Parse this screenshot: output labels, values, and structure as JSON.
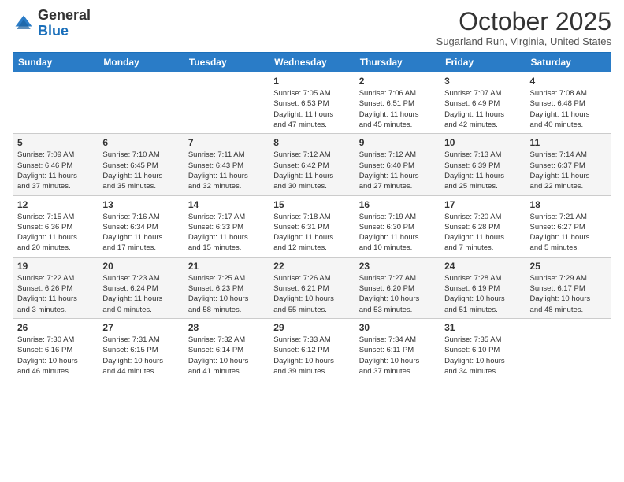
{
  "logo": {
    "general": "General",
    "blue": "Blue"
  },
  "header": {
    "month": "October 2025",
    "location": "Sugarland Run, Virginia, United States"
  },
  "weekdays": [
    "Sunday",
    "Monday",
    "Tuesday",
    "Wednesday",
    "Thursday",
    "Friday",
    "Saturday"
  ],
  "weeks": [
    [
      {
        "day": "",
        "info": ""
      },
      {
        "day": "",
        "info": ""
      },
      {
        "day": "",
        "info": ""
      },
      {
        "day": "1",
        "info": "Sunrise: 7:05 AM\nSunset: 6:53 PM\nDaylight: 11 hours\nand 47 minutes."
      },
      {
        "day": "2",
        "info": "Sunrise: 7:06 AM\nSunset: 6:51 PM\nDaylight: 11 hours\nand 45 minutes."
      },
      {
        "day": "3",
        "info": "Sunrise: 7:07 AM\nSunset: 6:49 PM\nDaylight: 11 hours\nand 42 minutes."
      },
      {
        "day": "4",
        "info": "Sunrise: 7:08 AM\nSunset: 6:48 PM\nDaylight: 11 hours\nand 40 minutes."
      }
    ],
    [
      {
        "day": "5",
        "info": "Sunrise: 7:09 AM\nSunset: 6:46 PM\nDaylight: 11 hours\nand 37 minutes."
      },
      {
        "day": "6",
        "info": "Sunrise: 7:10 AM\nSunset: 6:45 PM\nDaylight: 11 hours\nand 35 minutes."
      },
      {
        "day": "7",
        "info": "Sunrise: 7:11 AM\nSunset: 6:43 PM\nDaylight: 11 hours\nand 32 minutes."
      },
      {
        "day": "8",
        "info": "Sunrise: 7:12 AM\nSunset: 6:42 PM\nDaylight: 11 hours\nand 30 minutes."
      },
      {
        "day": "9",
        "info": "Sunrise: 7:12 AM\nSunset: 6:40 PM\nDaylight: 11 hours\nand 27 minutes."
      },
      {
        "day": "10",
        "info": "Sunrise: 7:13 AM\nSunset: 6:39 PM\nDaylight: 11 hours\nand 25 minutes."
      },
      {
        "day": "11",
        "info": "Sunrise: 7:14 AM\nSunset: 6:37 PM\nDaylight: 11 hours\nand 22 minutes."
      }
    ],
    [
      {
        "day": "12",
        "info": "Sunrise: 7:15 AM\nSunset: 6:36 PM\nDaylight: 11 hours\nand 20 minutes."
      },
      {
        "day": "13",
        "info": "Sunrise: 7:16 AM\nSunset: 6:34 PM\nDaylight: 11 hours\nand 17 minutes."
      },
      {
        "day": "14",
        "info": "Sunrise: 7:17 AM\nSunset: 6:33 PM\nDaylight: 11 hours\nand 15 minutes."
      },
      {
        "day": "15",
        "info": "Sunrise: 7:18 AM\nSunset: 6:31 PM\nDaylight: 11 hours\nand 12 minutes."
      },
      {
        "day": "16",
        "info": "Sunrise: 7:19 AM\nSunset: 6:30 PM\nDaylight: 11 hours\nand 10 minutes."
      },
      {
        "day": "17",
        "info": "Sunrise: 7:20 AM\nSunset: 6:28 PM\nDaylight: 11 hours\nand 7 minutes."
      },
      {
        "day": "18",
        "info": "Sunrise: 7:21 AM\nSunset: 6:27 PM\nDaylight: 11 hours\nand 5 minutes."
      }
    ],
    [
      {
        "day": "19",
        "info": "Sunrise: 7:22 AM\nSunset: 6:26 PM\nDaylight: 11 hours\nand 3 minutes."
      },
      {
        "day": "20",
        "info": "Sunrise: 7:23 AM\nSunset: 6:24 PM\nDaylight: 11 hours\nand 0 minutes."
      },
      {
        "day": "21",
        "info": "Sunrise: 7:25 AM\nSunset: 6:23 PM\nDaylight: 10 hours\nand 58 minutes."
      },
      {
        "day": "22",
        "info": "Sunrise: 7:26 AM\nSunset: 6:21 PM\nDaylight: 10 hours\nand 55 minutes."
      },
      {
        "day": "23",
        "info": "Sunrise: 7:27 AM\nSunset: 6:20 PM\nDaylight: 10 hours\nand 53 minutes."
      },
      {
        "day": "24",
        "info": "Sunrise: 7:28 AM\nSunset: 6:19 PM\nDaylight: 10 hours\nand 51 minutes."
      },
      {
        "day": "25",
        "info": "Sunrise: 7:29 AM\nSunset: 6:17 PM\nDaylight: 10 hours\nand 48 minutes."
      }
    ],
    [
      {
        "day": "26",
        "info": "Sunrise: 7:30 AM\nSunset: 6:16 PM\nDaylight: 10 hours\nand 46 minutes."
      },
      {
        "day": "27",
        "info": "Sunrise: 7:31 AM\nSunset: 6:15 PM\nDaylight: 10 hours\nand 44 minutes."
      },
      {
        "day": "28",
        "info": "Sunrise: 7:32 AM\nSunset: 6:14 PM\nDaylight: 10 hours\nand 41 minutes."
      },
      {
        "day": "29",
        "info": "Sunrise: 7:33 AM\nSunset: 6:12 PM\nDaylight: 10 hours\nand 39 minutes."
      },
      {
        "day": "30",
        "info": "Sunrise: 7:34 AM\nSunset: 6:11 PM\nDaylight: 10 hours\nand 37 minutes."
      },
      {
        "day": "31",
        "info": "Sunrise: 7:35 AM\nSunset: 6:10 PM\nDaylight: 10 hours\nand 34 minutes."
      },
      {
        "day": "",
        "info": ""
      }
    ]
  ]
}
